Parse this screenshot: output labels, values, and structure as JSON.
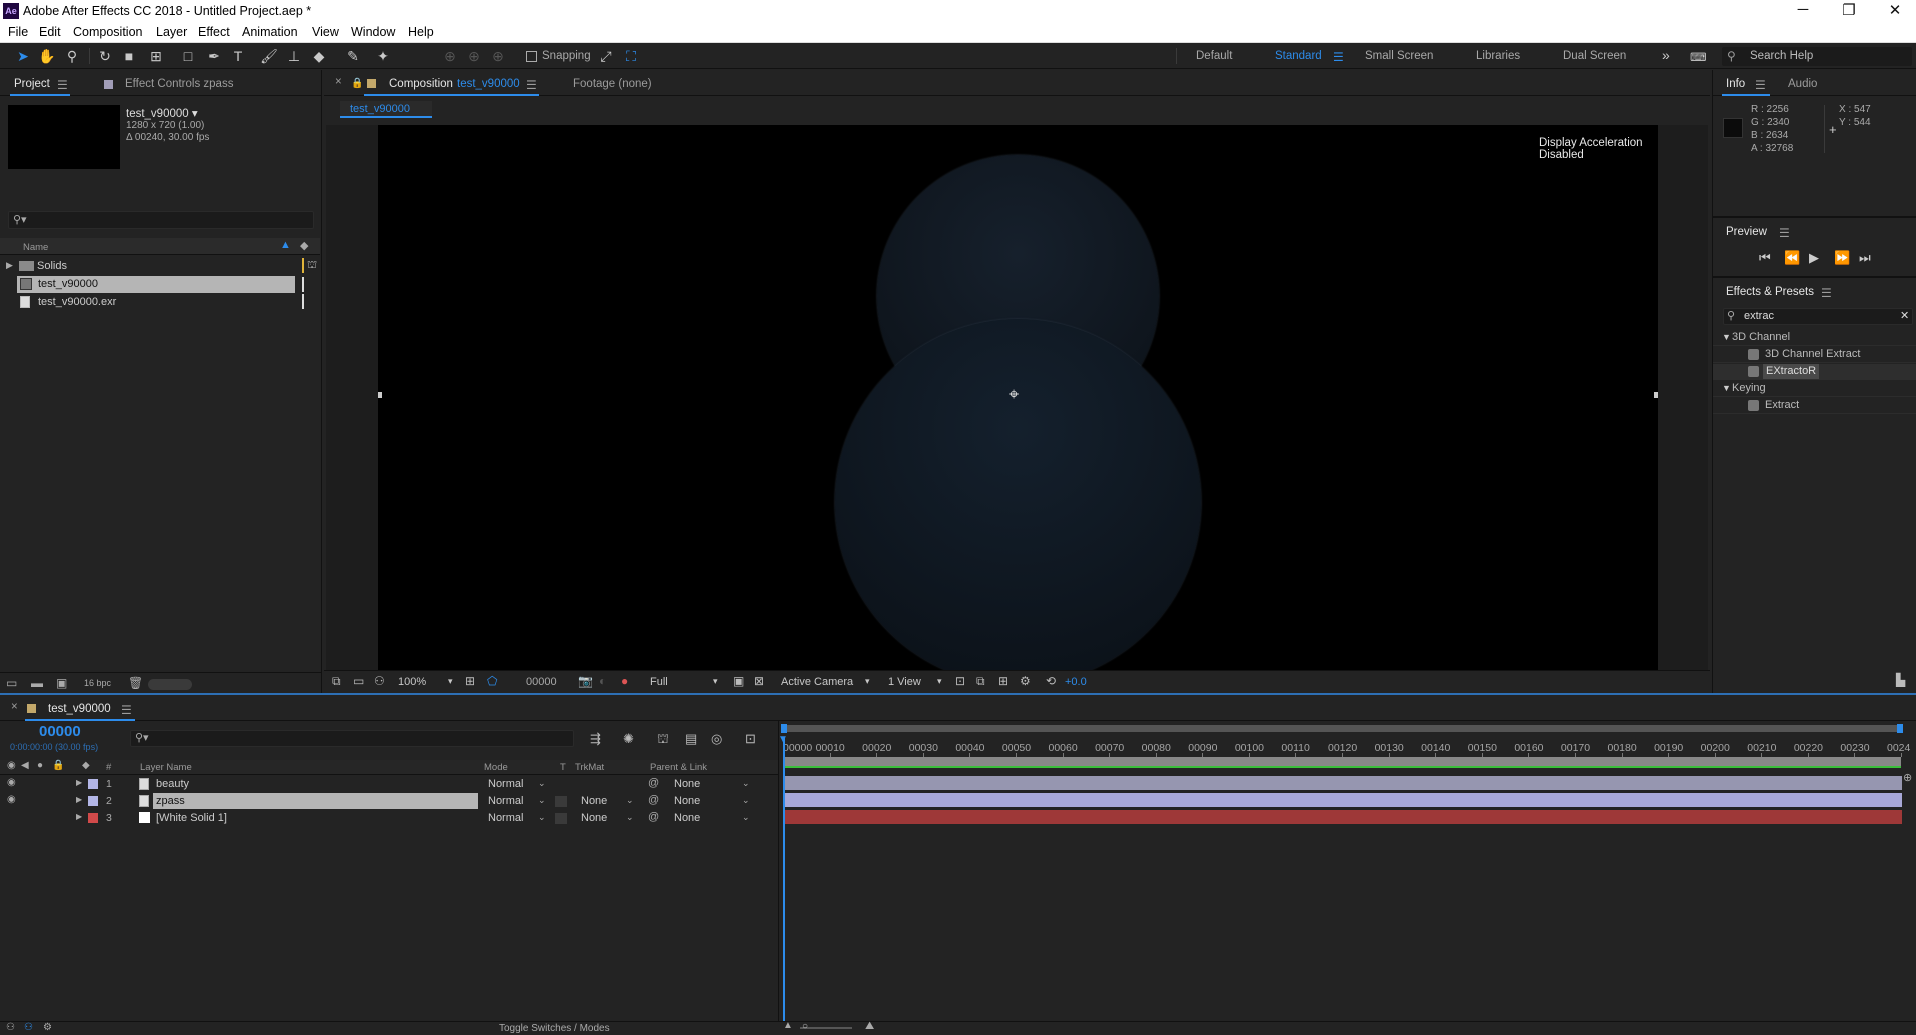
{
  "app": {
    "title": "Adobe After Effects CC 2018 - Untitled Project.aep *",
    "logo": "Ae"
  },
  "window_controls": {
    "minimize": "─",
    "restore": "❐",
    "close": "✕"
  },
  "menu": [
    "File",
    "Edit",
    "Composition",
    "Layer",
    "Effect",
    "Animation",
    "View",
    "Window",
    "Help"
  ],
  "toolbar": {
    "snapping": "Snapping",
    "workspaces": [
      "Default",
      "Standard",
      "Small Screen",
      "Libraries",
      "Dual Screen"
    ],
    "active_workspace": "Standard",
    "more": "»",
    "search_help": "Search Help"
  },
  "project": {
    "tab": "Project",
    "tab2": "Effect Controls zpass",
    "selected_name": "test_v90000 ▾",
    "selected_info1": "1280 x 720 (1.00)",
    "selected_info2": "Δ 00240, 30.00 fps",
    "search_placeholder": "",
    "col_name": "Name",
    "items": [
      {
        "name": "Solids",
        "type": "folder"
      },
      {
        "name": "test_v90000",
        "type": "comp",
        "selected": true
      },
      {
        "name": "test_v90000.exr",
        "type": "footage"
      }
    ],
    "bpc": "16 bpc"
  },
  "viewer": {
    "close": "×",
    "tab": "Composition",
    "comp_name": "test_v90000",
    "footage_tab": "Footage (none)",
    "subtab": "test_v90000",
    "notice": "Display Acceleration Disabled",
    "zoom": "100%",
    "timecode": "00000",
    "resolution": "Full",
    "camera": "Active Camera",
    "views": "1 View",
    "exposure": "+0.0"
  },
  "info": {
    "tab": "Info",
    "tab2": "Audio",
    "r": "R : 2256",
    "g": "G : 2340",
    "b": "B : 2634",
    "a": "A : 32768",
    "x": "X : 547",
    "y": "Y : 544"
  },
  "preview": {
    "title": "Preview"
  },
  "effects": {
    "title": "Effects & Presets",
    "search": "extrac",
    "groups": [
      {
        "name": "3D Channel",
        "items": [
          "3D Channel Extract",
          "EXtractoR"
        ]
      },
      {
        "name": "Keying",
        "items": [
          "Extract"
        ]
      }
    ]
  },
  "timeline": {
    "close": "×",
    "tab": "test_v90000",
    "timecode": "00000",
    "fps": "0:00:00:00 (30.00 fps)",
    "headers": {
      "num": "#",
      "layer": "Layer Name",
      "mode": "Mode",
      "t": "T",
      "trkmat": "TrkMat",
      "parent": "Parent & Link"
    },
    "layers": [
      {
        "num": "1",
        "name": "beauty",
        "mode": "Normal",
        "trkmat": "",
        "parent": "None",
        "color": "#b3b6e6",
        "selected": false
      },
      {
        "num": "2",
        "name": "zpass",
        "mode": "Normal",
        "trkmat": "None",
        "parent": "None",
        "color": "#b3b6e6",
        "selected": true
      },
      {
        "num": "3",
        "name": "[White Solid 1]",
        "mode": "Normal",
        "trkmat": "None",
        "parent": "None",
        "color": "#d14a4a",
        "selected": false
      }
    ],
    "ruler": [
      "00000",
      "00010",
      "00020",
      "00030",
      "00040",
      "00050",
      "00060",
      "00070",
      "00080",
      "00090",
      "00100",
      "00110",
      "00120",
      "00130",
      "00140",
      "00150",
      "00160",
      "00170",
      "00180",
      "00190",
      "00200",
      "00210",
      "00220",
      "00230",
      "0024"
    ],
    "toggle": "Toggle Switches / Modes"
  }
}
